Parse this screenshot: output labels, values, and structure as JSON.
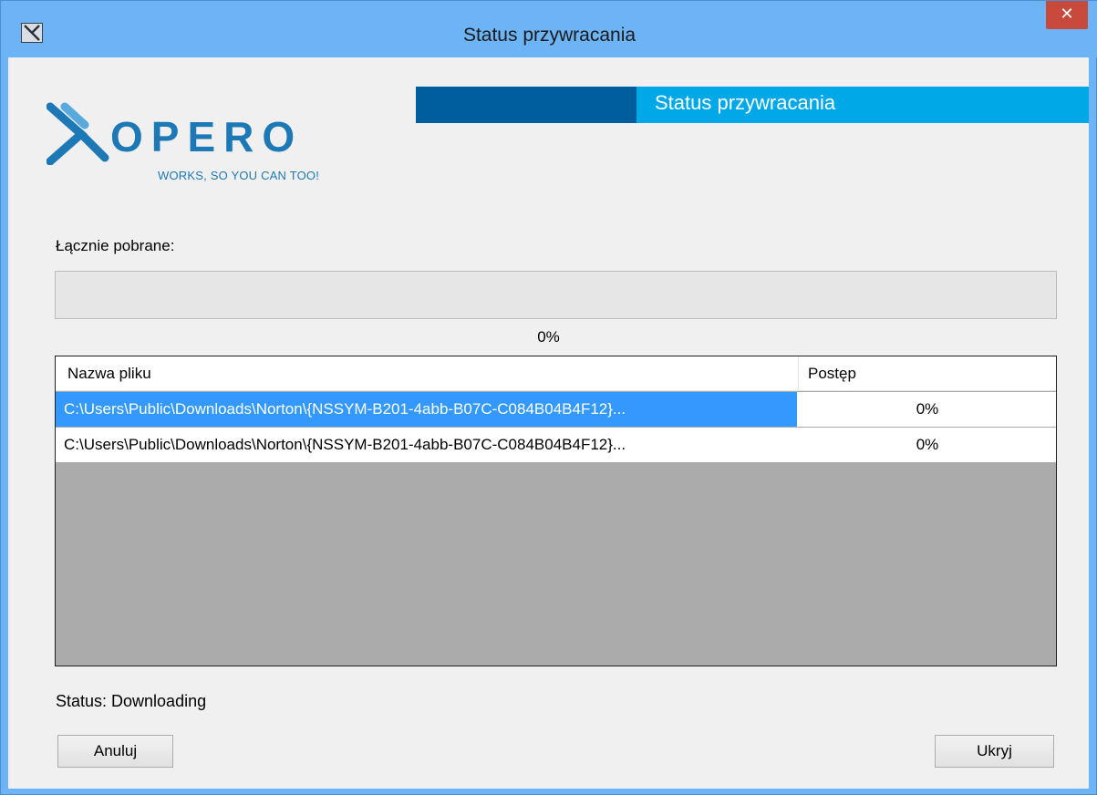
{
  "window": {
    "title": "Status przywracania",
    "close_label": "✕"
  },
  "logo": {
    "brand": "OPERO",
    "tagline": "WORKS, SO YOU CAN TOO!"
  },
  "banner": {
    "text": "Status przywracania"
  },
  "total": {
    "label": "Łącznie pobrane:",
    "progress": 0,
    "percent_text": "0%"
  },
  "file_list": {
    "columns": [
      "Nazwa pliku",
      "Postęp"
    ],
    "rows": [
      {
        "name": "C:\\Users\\Public\\Downloads\\Norton\\{NSSYM-B201-4abb-B07C-C084B04B4F12}...",
        "progress": "0%",
        "selected": true
      },
      {
        "name": "C:\\Users\\Public\\Downloads\\Norton\\{NSSYM-B201-4abb-B07C-C084B04B4F12}...",
        "progress": "0%",
        "selected": false
      }
    ]
  },
  "status": {
    "text": "Status: Downloading"
  },
  "buttons": {
    "cancel": "Anuluj",
    "hide": "Ukryj"
  },
  "colors": {
    "titlebar": "#6db4f7",
    "close": "#c74a3c",
    "banner_dark": "#005e9e",
    "banner_light": "#00a8e8",
    "selection": "#3399ff",
    "logo": "#1d78b6"
  }
}
